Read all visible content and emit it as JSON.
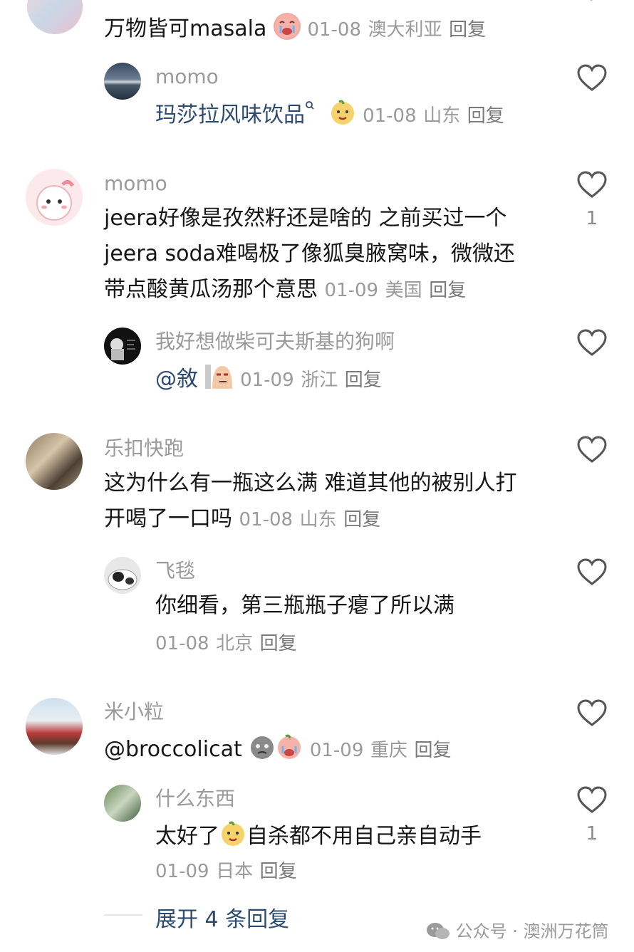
{
  "comments": [
    {
      "text": "万物皆可masala",
      "time": "01-08",
      "location": "澳大利亚",
      "reply_label": "回复",
      "replies": [
        {
          "user": "momo",
          "text": "玛莎拉风味饮品",
          "time": "01-08",
          "location": "山东",
          "reply_label": "回复"
        }
      ]
    },
    {
      "user": "momo",
      "text_lines": [
        "jeera好像是孜然籽还是啥的 之前买过一个",
        "jeera soda难喝极了像狐臭腋窝味，微微还",
        "带点酸黄瓜汤那个意思"
      ],
      "time": "01-09",
      "location": "美国",
      "reply_label": "回复",
      "likes": "1",
      "replies": [
        {
          "user": "我好想做柴可夫斯基的狗啊",
          "text": "@敘",
          "time": "01-09",
          "location": "浙江",
          "reply_label": "回复"
        }
      ]
    },
    {
      "user": "乐扣快跑",
      "text_lines": [
        "这为什么有一瓶这么满 难道其他的被别人打",
        "开喝了一口吗"
      ],
      "time": "01-08",
      "location": "山东",
      "reply_label": "回复",
      "replies": [
        {
          "user": "飞毯",
          "text": "你细看，第三瓶瓶子瘪了所以满",
          "time": "01-08",
          "location": "北京",
          "reply_label": "回复"
        }
      ]
    },
    {
      "user": "米小粒",
      "text": "@broccolicat",
      "time": "01-09",
      "location": "重庆",
      "reply_label": "回复",
      "replies": [
        {
          "user": "什么东西",
          "text_a": "太好了",
          "text_b": "自杀都不用自己亲自动手",
          "time": "01-09",
          "location": "日本",
          "reply_label": "回复",
          "likes": "1"
        }
      ]
    }
  ],
  "expand_label": "展开 4 条回复",
  "watermark": "公众号 · 澳洲万花筒",
  "colors": {
    "accent": "#2b4a6e",
    "meta": "#9a9a9a"
  }
}
